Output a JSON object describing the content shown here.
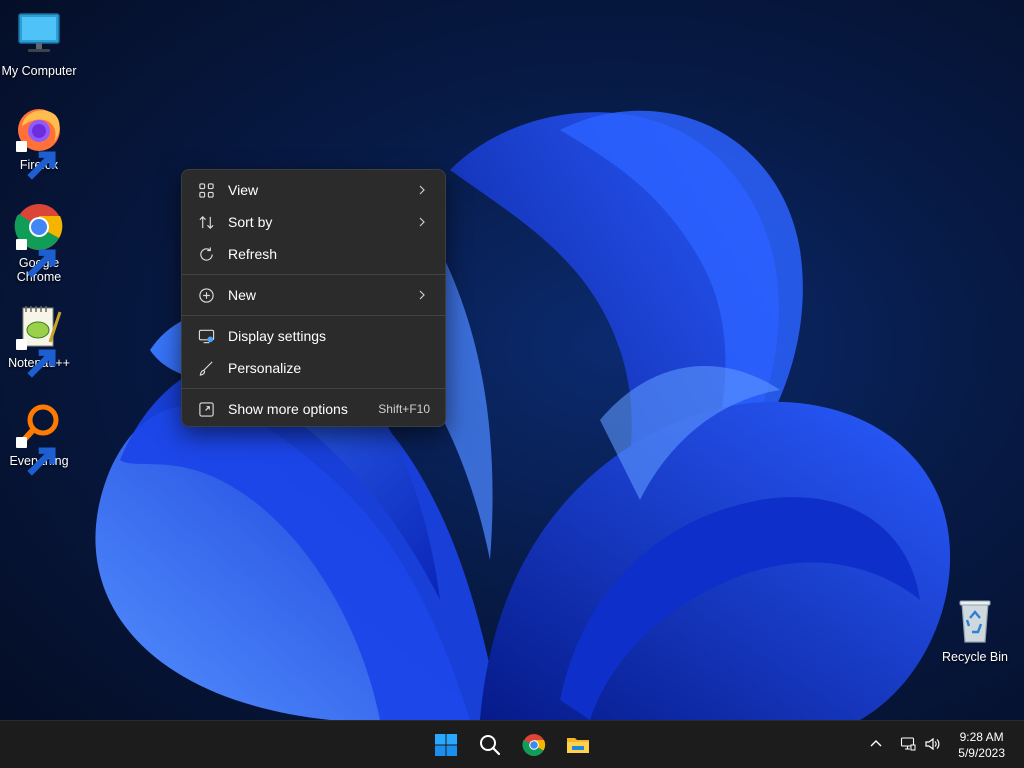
{
  "desktop": {
    "icons": [
      {
        "label": "My Computer"
      },
      {
        "label": "Firefox"
      },
      {
        "label": "Google Chrome"
      },
      {
        "label": "Notepad++"
      },
      {
        "label": "Everything"
      },
      {
        "label": "Recycle Bin"
      }
    ]
  },
  "context_menu": {
    "items": [
      {
        "label": "View",
        "icon": "grid-icon",
        "submenu": true
      },
      {
        "label": "Sort by",
        "icon": "sort-icon",
        "submenu": true
      },
      {
        "label": "Refresh",
        "icon": "refresh-icon"
      },
      {
        "label": "New",
        "icon": "plus-circle-icon",
        "submenu": true
      },
      {
        "label": "Display settings",
        "icon": "display-icon"
      },
      {
        "label": "Personalize",
        "icon": "brush-icon"
      },
      {
        "label": "Show more options",
        "icon": "more-options-icon",
        "shortcut": "Shift+F10"
      }
    ]
  },
  "taskbar": {
    "apps": [
      "start-icon",
      "search-icon",
      "chrome-icon",
      "file-explorer-icon"
    ],
    "tray": [
      "chevron-up-icon",
      "network-icon",
      "volume-icon"
    ],
    "clock": {
      "time": "9:28 AM",
      "date": "5/9/2023"
    }
  },
  "colors": {
    "menu_bg": "#2b2b2b",
    "taskbar_bg": "#1c1c1c",
    "wallpaper_accent": "#1e4dff"
  }
}
